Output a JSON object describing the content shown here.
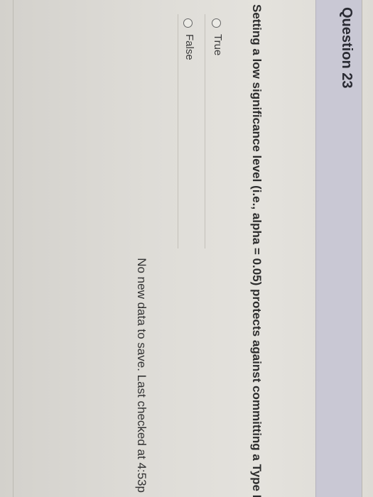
{
  "question": {
    "title": "Question 23",
    "text": "Setting a low significance level (i.e., alpha = 0.05) protects against committing a Type I erro",
    "options": [
      {
        "label": "True",
        "selected": false
      },
      {
        "label": "False",
        "selected": false
      }
    ]
  },
  "status": {
    "save_message": "No new data to save. Last checked at 4:53p"
  }
}
